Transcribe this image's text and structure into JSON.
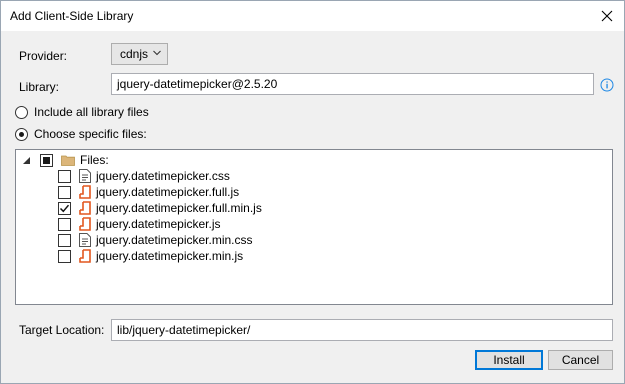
{
  "window": {
    "title": "Add Client-Side Library",
    "close_icon": "close-icon"
  },
  "provider": {
    "label": "Provider:",
    "value": "cdnjs"
  },
  "library": {
    "label": "Library:",
    "value": "jquery-datetimepicker@2.5.20",
    "info_icon": "info-icon"
  },
  "options": {
    "include_all": {
      "label": "Include all library files",
      "selected": false
    },
    "choose_specific": {
      "label": "Choose specific files:",
      "selected": true
    }
  },
  "tree": {
    "root": {
      "label": "Files:",
      "state": "partial"
    },
    "files": [
      {
        "name": "jquery.datetimepicker.css",
        "type": "css",
        "checked": false
      },
      {
        "name": "jquery.datetimepicker.full.js",
        "type": "js",
        "checked": false
      },
      {
        "name": "jquery.datetimepicker.full.min.js",
        "type": "js",
        "checked": true
      },
      {
        "name": "jquery.datetimepicker.js",
        "type": "js",
        "checked": false
      },
      {
        "name": "jquery.datetimepicker.min.css",
        "type": "css",
        "checked": false
      },
      {
        "name": "jquery.datetimepicker.min.js",
        "type": "js",
        "checked": false
      }
    ]
  },
  "target": {
    "label": "Target Location:",
    "value": "lib/jquery-datetimepicker/"
  },
  "buttons": {
    "install": "Install",
    "cancel": "Cancel"
  },
  "colors": {
    "js_icon": "#e2571e",
    "folder": "#dcb67a",
    "info": "#1e88e5",
    "default_button_border": "#0078d7"
  }
}
